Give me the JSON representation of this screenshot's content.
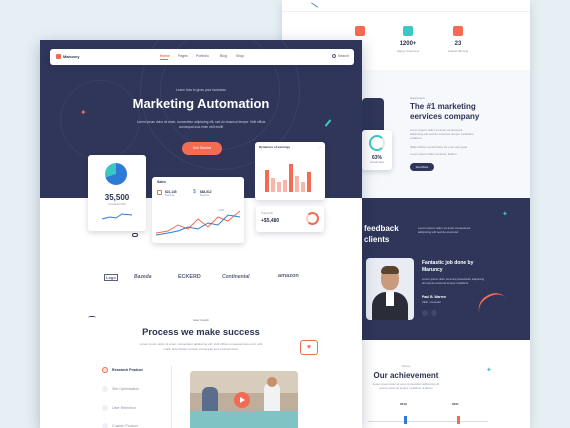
{
  "back_page": {
    "stats": [
      {
        "value": "",
        "label": ""
      },
      {
        "value": "1200+",
        "label": "Happy Customers"
      },
      {
        "value": "23",
        "label": "Awards Winning"
      }
    ],
    "about": {
      "eyebrow": "Supporters",
      "title_line1": "The #1 marketing",
      "title_line2": "eervices company",
      "body": "Lorem ipsum dolor sit amet consectetur adipiscing elit sed do eiusmod tempor incididunt ut labore",
      "check1": "Wide offices constructive for your own goal",
      "check2": "Lorem ipsum dolor sit amet, bellum",
      "button": "Get More",
      "progress_value": "63%",
      "progress_label": "Growth Rate"
    },
    "feedback": {
      "title_line1": "feedback",
      "title_line2": "clients",
      "body": "Lorem ipsum dolor sit amet consectetur adipiscing elit sed do eiusmod",
      "quote_title_line1": "Fantastic job done by",
      "quote_title_line2": "Maruncy",
      "quote_body": "Lorem ipsum dolor sit amet consectetur adipiscing elit sed do eiusmod tempor incididunt",
      "author_name": "Paul B. Warren",
      "author_role": "CEO - Founder"
    },
    "achievement": {
      "eyebrow": "Victory",
      "title": "Our achievement",
      "body": "Lorem ipsum dolor sit amet consectetur adipiscing elit sed do eiusmod tempor incididunt ut labore",
      "year_left": "2019",
      "year_right": "2021"
    }
  },
  "front_page": {
    "brand": "Maruncy",
    "nav": [
      "Home",
      "Pages",
      "Portfolio",
      "Blog",
      "Shop"
    ],
    "search_label": "Search",
    "hero": {
      "eyebrow": "Learn how to grow your business",
      "title": "Marketing Automation",
      "body_line1": "Lorem ipsum dolor sit amet, consectetur adipiscing elit, sed do eiusmod tempor. Velit officia",
      "body_line2": "consequat duis enim velit mollit",
      "cta": "Get Started"
    },
    "widgets": {
      "big_stat": "35,500",
      "big_stat_label": "Increased 20%",
      "sales_title": "Sales",
      "sales_a_value": "$21,145",
      "sales_a_label": "Revenue",
      "sales_b_value": "$84,512",
      "sales_b_label": "Revenue",
      "chart_badge": "+21%",
      "dynamics_title": "Dynamics of earnings",
      "total_label": "Total profit",
      "total_value": "+$5,480"
    },
    "partners": [
      "Logo",
      "Bazeda",
      "ECKERD",
      "Continental",
      "amazon"
    ],
    "process": {
      "eyebrow": "How it work",
      "title": "Process we make success",
      "body_line1": "Lorem ipsum dolor sit amet, consectetur adipiscing elit. Velit officia consequat duis enim velit",
      "body_line2": "mollit. Exercitation veniam consequat sunt nostrud amet.",
      "steps": [
        "Research Product",
        "Site Optimization",
        "User Retention",
        "Custom Product"
      ]
    }
  },
  "colors": {
    "navy": "#2f3659",
    "accent": "#f36b52",
    "teal": "#3cc6c4",
    "blue": "#2d7bd6"
  }
}
